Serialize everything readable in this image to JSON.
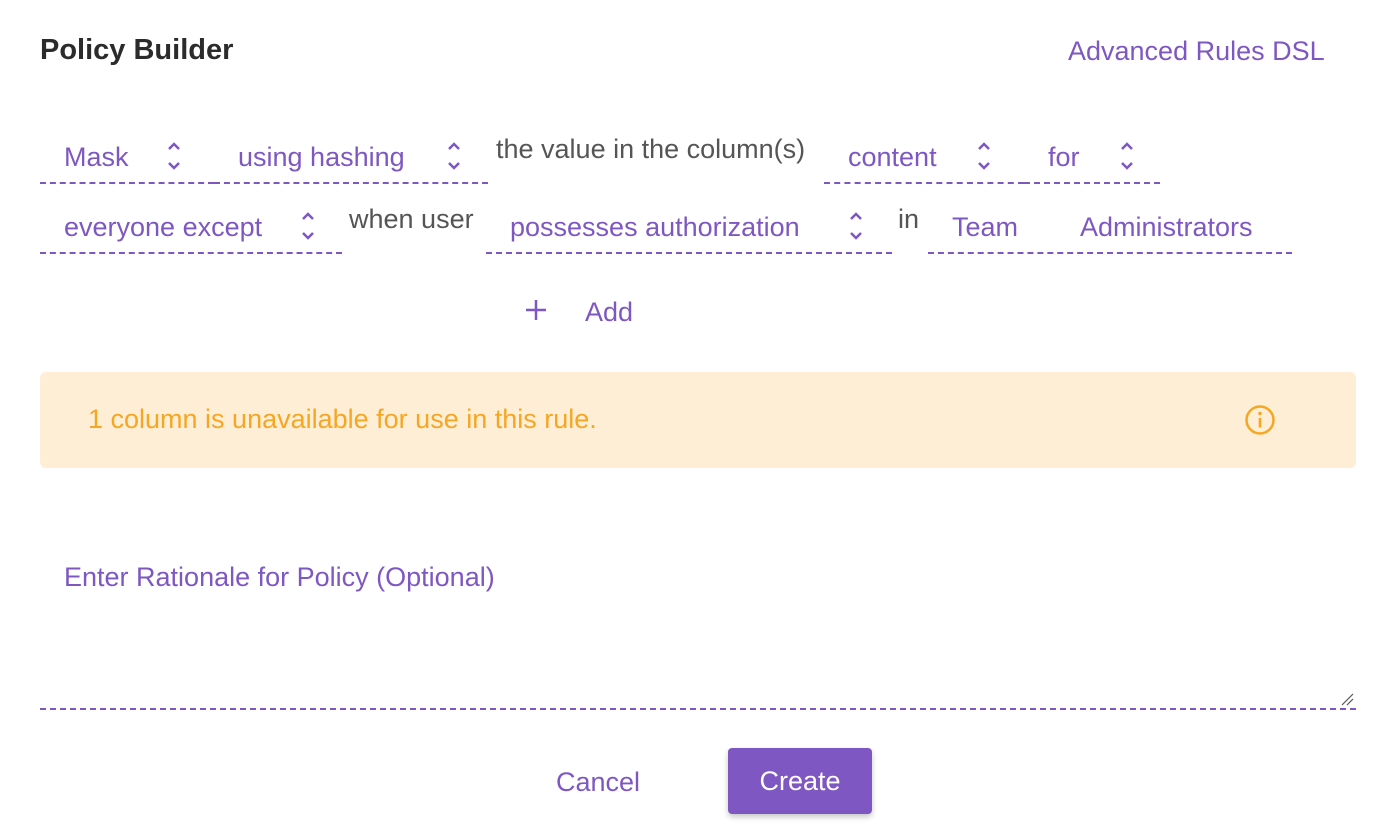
{
  "header": {
    "title": "Policy Builder",
    "dsl_link": "Advanced Rules DSL"
  },
  "rule": {
    "action": "Mask",
    "method": "using hashing",
    "text_column": "the value in the column(s)",
    "column": "content",
    "for": "for",
    "audience": "everyone except",
    "text_when": "when user",
    "condition": "possesses authorization",
    "text_in": "in",
    "group_part1": "Team",
    "group_part2": "Administrators"
  },
  "add": {
    "label": "Add"
  },
  "alert": {
    "message": "1 column is unavailable for use in this rule."
  },
  "rationale": {
    "placeholder": "Enter Rationale for Policy (Optional)"
  },
  "buttons": {
    "cancel": "Cancel",
    "create": "Create"
  },
  "colors": {
    "accent": "#7e57c2",
    "warning_bg": "#ffeed6",
    "warning_text": "#f5a623"
  }
}
